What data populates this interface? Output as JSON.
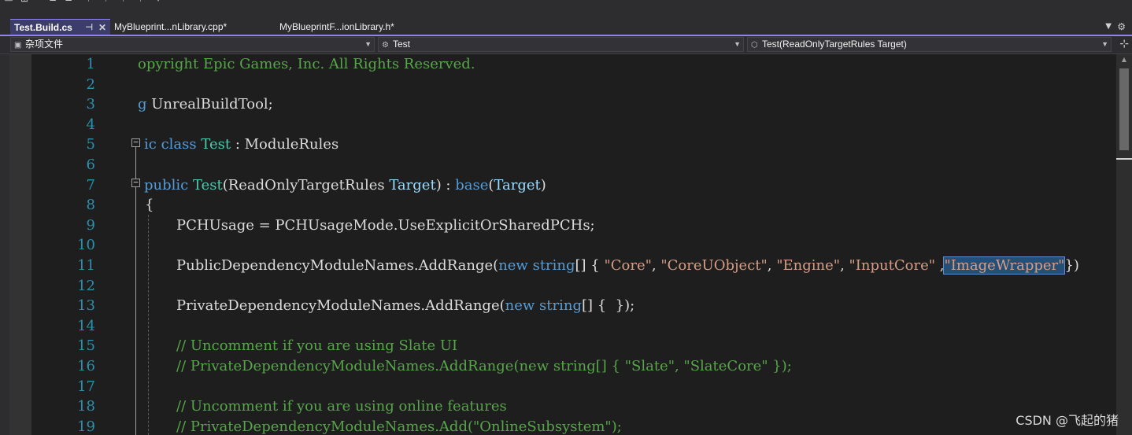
{
  "tabs": [
    {
      "label": "Test.Build.cs",
      "active": true
    },
    {
      "label": "MyBlueprint...nLibrary.cpp*",
      "active": false
    },
    {
      "label": "MyBlueprintF...ionLibrary.h*",
      "active": false
    }
  ],
  "navbar": {
    "project_combo": "杂项文件",
    "class_combo": "Test",
    "member_combo": "Test(ReadOnlyTargetRules Target)"
  },
  "editor": {
    "line_numbers": [
      "1",
      "2",
      "3",
      "4",
      "5",
      "6",
      "7",
      "8",
      "9",
      "10",
      "11",
      "12",
      "13",
      "14",
      "15",
      "16",
      "17",
      "18",
      "19"
    ],
    "lines": {
      "l1": [
        "opyright Epic Games, Inc. All Rights Reserved."
      ],
      "l3": [
        "g",
        " UnrealBuildTool;"
      ],
      "l5": [
        "ic",
        " ",
        "class",
        " ",
        "Test",
        " : ModuleRules"
      ],
      "l7": [
        "public",
        " ",
        "Test",
        "(ReadOnlyTargetRules ",
        "Target",
        ") : ",
        "base",
        "(",
        "Target",
        ")"
      ],
      "l8": [
        "{"
      ],
      "l9": [
        "PCHUsage = PCHUsageMode.UseExplicitOrSharedPCHs;"
      ],
      "l11": [
        "PublicDependencyModuleNames.AddRange(",
        "new",
        " ",
        "string",
        "[] { ",
        "\"Core\"",
        ", ",
        "\"CoreUObject\"",
        ", ",
        "\"Engine\"",
        ", ",
        "\"InputCore\"",
        " ,",
        "\"ImageWrapper\"",
        "})"
      ],
      "l13": [
        "PrivateDependencyModuleNames.AddRange(",
        "new",
        " ",
        "string",
        "[] {  });"
      ],
      "l15": [
        "// Uncomment if you are using Slate UI"
      ],
      "l16": [
        "// PrivateDependencyModuleNames.AddRange(new string[] { \"Slate\", \"SlateCore\" });"
      ],
      "l18": [
        "// Uncomment if you are using online features"
      ],
      "l19": [
        "// PrivateDependencyModuleNames.Add(\"OnlineSubsystem\");"
      ]
    }
  },
  "watermark": "CSDN @飞起的猪",
  "colors": {
    "accent": "#9184ee",
    "keyword": "#569cd6",
    "type": "#4ec9b0",
    "string": "#d69d85",
    "comment": "#57a64a",
    "line_number": "#2b91af"
  }
}
